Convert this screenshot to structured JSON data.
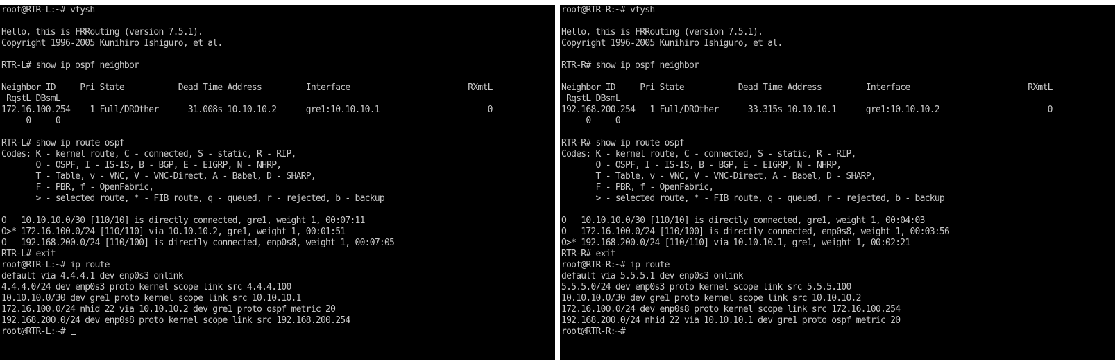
{
  "left_terminal": {
    "lines": [
      "root@RTR-L:~# vtysh",
      "",
      "Hello, this is FRRouting (version 7.5.1).",
      "Copyright 1996-2005 Kunihiro Ishiguro, et al.",
      "",
      "RTR-L# show ip ospf neighbor",
      "",
      "Neighbor ID     Pri State           Dead Time Address         Interface                        RXmtL",
      " RqstL DBsmL",
      "172.16.100.254    1 Full/DROther      31.008s 10.10.10.2      gre1:10.10.10.1                      0",
      "     0     0",
      "",
      "RTR-L# show ip route ospf",
      "Codes: K - kernel route, C - connected, S - static, R - RIP,",
      "       O - OSPF, I - IS-IS, B - BGP, E - EIGRP, N - NHRP,",
      "       T - Table, v - VNC, V - VNC-Direct, A - Babel, D - SHARP,",
      "       F - PBR, f - OpenFabric,",
      "       > - selected route, * - FIB route, q - queued, r - rejected, b - backup",
      "",
      "O   10.10.10.0/30 [110/10] is directly connected, gre1, weight 1, 00:07:11",
      "O>* 172.16.100.0/24 [110/110] via 10.10.10.2, gre1, weight 1, 00:01:51",
      "O   192.168.200.0/24 [110/100] is directly connected, enp0s8, weight 1, 00:07:05",
      "RTR-L# exit",
      "root@RTR-L:~# ip route",
      "default via 4.4.4.1 dev enp0s3 onlink",
      "4.4.4.0/24 dev enp0s3 proto kernel scope link src 4.4.4.100",
      "10.10.10.0/30 dev gre1 proto kernel scope link src 10.10.10.1",
      "172.16.100.0/24 nhid 22 via 10.10.10.2 dev gre1 proto ospf metric 20",
      "192.168.200.0/24 dev enp0s8 proto kernel scope link src 192.168.200.254",
      "root@RTR-L:~# "
    ]
  },
  "right_terminal": {
    "lines": [
      "root@RTR-R:~# vtysh",
      "",
      "Hello, this is FRRouting (version 7.5.1).",
      "Copyright 1996-2005 Kunihiro Ishiguro, et al.",
      "",
      "RTR-R# show ip ospf neighbor",
      "",
      "Neighbor ID     Pri State           Dead Time Address         Interface                        RXmtL",
      " RqstL DBsmL",
      "192.168.200.254   1 Full/DROther      33.315s 10.10.10.1      gre1:10.10.10.2                      0",
      "     0     0",
      "",
      "RTR-R# show ip route ospf",
      "Codes: K - kernel route, C - connected, S - static, R - RIP,",
      "       O - OSPF, I - IS-IS, B - BGP, E - EIGRP, N - NHRP,",
      "       T - Table, v - VNC, V - VNC-Direct, A - Babel, D - SHARP,",
      "       F - PBR, f - OpenFabric,",
      "       > - selected route, * - FIB route, q - queued, r - rejected, b - backup",
      "",
      "O   10.10.10.0/30 [110/10] is directly connected, gre1, weight 1, 00:04:03",
      "O   172.16.100.0/24 [110/100] is directly connected, enp0s8, weight 1, 00:03:56",
      "O>* 192.168.200.0/24 [110/110] via 10.10.10.1, gre1, weight 1, 00:02:21",
      "RTR-R# exit",
      "root@RTR-R:~# ip route",
      "default via 5.5.5.1 dev enp0s3 onlink",
      "5.5.5.0/24 dev enp0s3 proto kernel scope link src 5.5.5.100",
      "10.10.10.0/30 dev gre1 proto kernel scope link src 10.10.10.2",
      "172.16.100.0/24 dev enp0s8 proto kernel scope link src 172.16.100.254",
      "192.168.200.0/24 nhid 22 via 10.10.10.1 dev gre1 proto ospf metric 20",
      "root@RTR-R:~# "
    ]
  },
  "colors": {
    "terminal_bg": "#000000",
    "terminal_fg": "#c8c8c8",
    "frame": "#ffffff"
  }
}
